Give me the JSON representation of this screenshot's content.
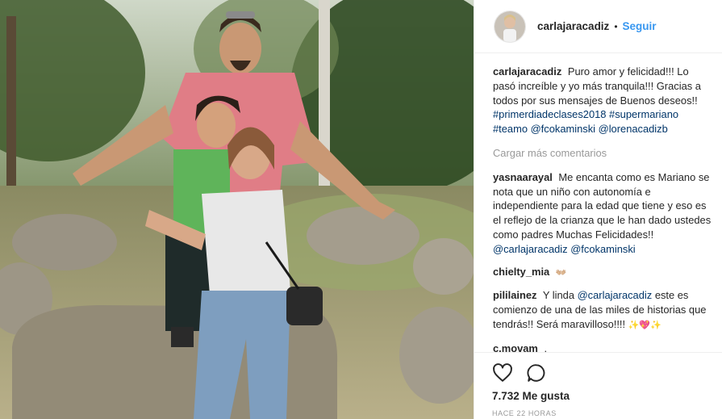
{
  "photo": {
    "alt": "",
    "icon": "photo"
  },
  "header": {
    "username": "carlajaracadiz",
    "separator": "•",
    "follow_label": "Seguir"
  },
  "caption": {
    "username": "carlajaracadiz",
    "text": "Puro amor y felicidad!!! Lo pasó increíble y yo más tranquila!!! Gracias a todos por sus mensajes de Buenos deseos!!",
    "tags": [
      "#primerdiadeclases2018",
      "#supermariano",
      "#teamo",
      "@fcokaminski",
      "@lorenacadizb"
    ]
  },
  "load_more_label": "Cargar más comentarios",
  "comments": [
    {
      "username": "yasnaarayal",
      "text": "Me encanta como es Mariano se nota que un niño con autonomía e independiente para la edad que tiene y eso es el reflejo de la crianza que le han dado ustedes como padres Muchas Felicidades!!",
      "mentions": [
        "@carlajaracadiz",
        "@fcokaminski"
      ]
    },
    {
      "username": "chielty_mia",
      "text": "👐🏼"
    },
    {
      "username": "pililainez",
      "text_before": "Y linda",
      "mention": "@carlajaracadiz",
      "text_after": "este es comienzo de una de las miles de historias que tendrás!! Será maravilloso!!!!",
      "emoji": "✨💖✨"
    },
    {
      "username": "c.movam",
      "text": "."
    }
  ],
  "actions": {
    "like_icon": "heart-outline",
    "comment_icon": "speech-bubble"
  },
  "likes_label": "7.732 Me gusta",
  "timestamp": "HACE 22 HORAS"
}
